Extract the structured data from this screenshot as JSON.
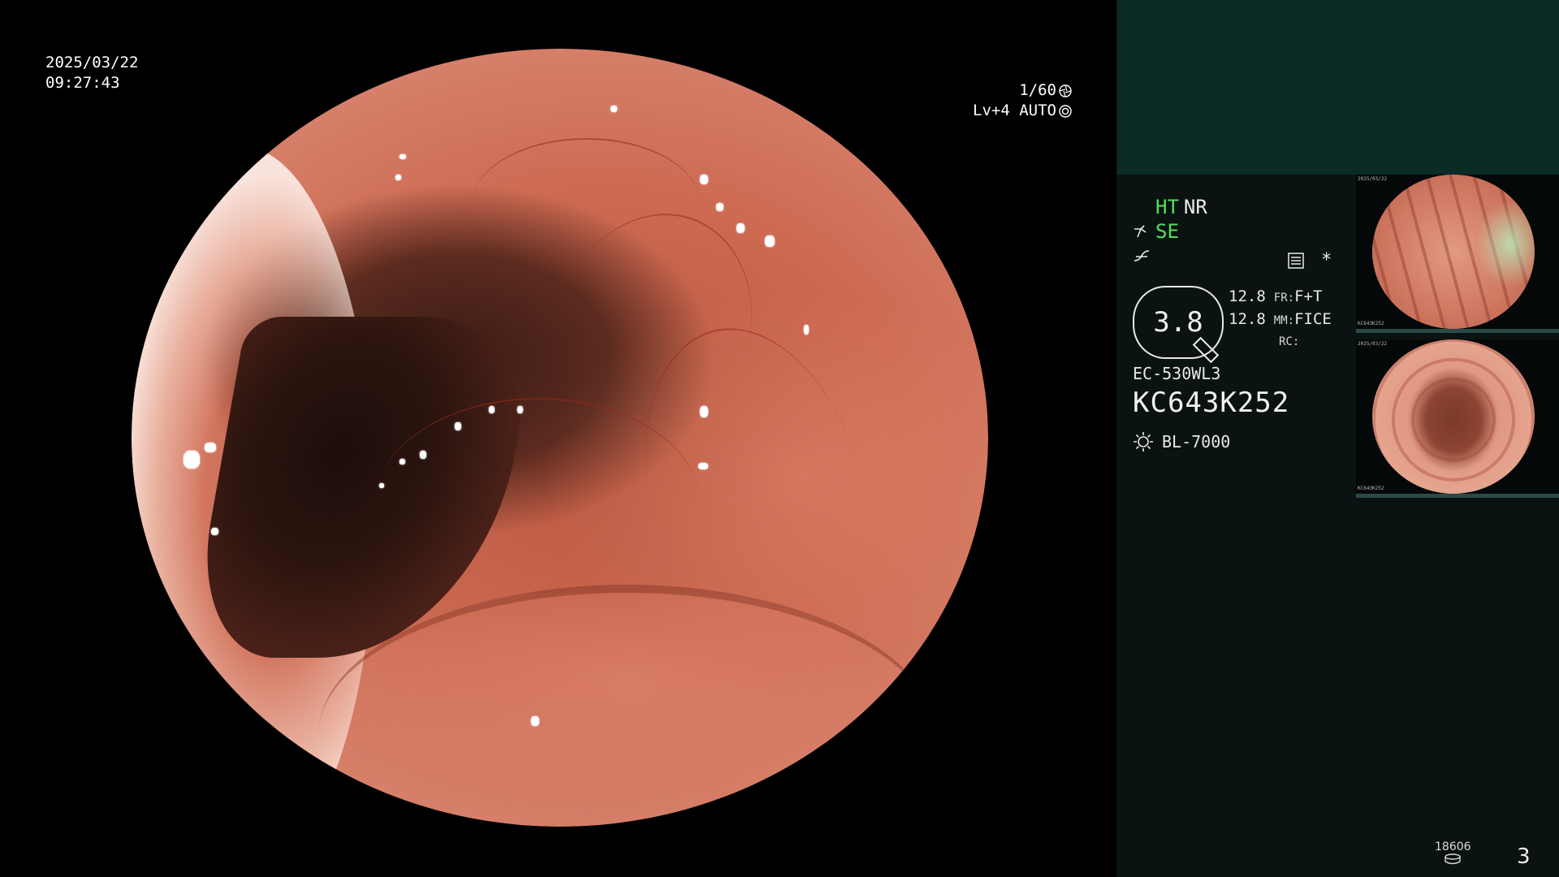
{
  "overlay": {
    "date": "2025/03/22",
    "time": "09:27:43",
    "shutter": "1/60",
    "level": "Lv+4 AUTO"
  },
  "panel": {
    "mode_ht": "HT",
    "mode_nr": "NR",
    "mode_se": "SE",
    "zoom_value": "3.8",
    "param_1_value": "12.8",
    "param_2_value": "12.8",
    "fr_label": "FR:",
    "fr_value": "F+T",
    "mm_label": "MM:",
    "mm_value": "FICE",
    "rc_label": "RC:",
    "scope_model": "EC-530WL3",
    "scope_serial": "KC643K252",
    "light_source": "BL-7000",
    "asterisk": "*"
  },
  "thumbnails": [
    {
      "label_top": "2025/03/22",
      "label_bottom": "KC643K252"
    },
    {
      "label_top": "2025/03/22",
      "label_bottom": "KC643K252"
    }
  ],
  "footer": {
    "storage_count": "18606",
    "page_number": "3"
  },
  "colors": {
    "panel_bg": "#0a1312",
    "panel_top_bg": "#0c2a26",
    "accent_green": "#55e05a"
  }
}
